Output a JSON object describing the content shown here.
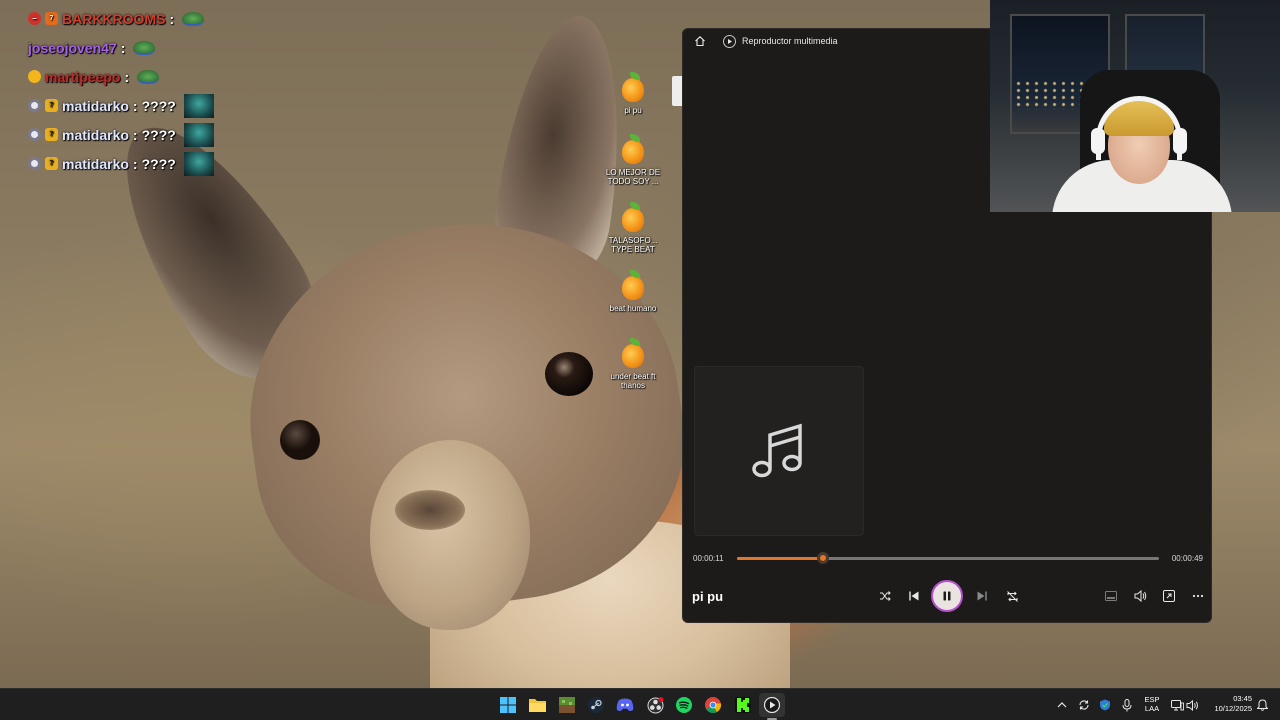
{
  "chat": {
    "lines": [
      {
        "user": "BARKKROOMS",
        "user_color": "#d43c2c",
        "separator": ":",
        "message": "",
        "badges": [
          "no-entry-icon",
          "seventv-badge-icon"
        ],
        "emotes": [
          "turtle-emote"
        ]
      },
      {
        "user": "joseojoven47",
        "user_color": "#a562e6",
        "separator": ":",
        "message": "",
        "badges": [],
        "emotes": [
          "turtle-emote"
        ]
      },
      {
        "user": "martipeepo",
        "user_color": "#c42a2a",
        "separator": ":",
        "message": "",
        "badges": [
          "yellow-circle-badge-icon"
        ],
        "emotes": [
          "turtle-emote"
        ]
      },
      {
        "user": "matidarko",
        "user_color": "#dfe6ff",
        "separator": ":",
        "message": " ????",
        "badges": [
          "subscriber-badge-icon",
          "seventv-badge-icon"
        ],
        "emotes": [
          "teal-emote"
        ]
      },
      {
        "user": "matidarko",
        "user_color": "#dfe6ff",
        "separator": ":",
        "message": " ????",
        "badges": [
          "subscriber-badge-icon",
          "seventv-badge-icon"
        ],
        "emotes": [
          "teal-emote"
        ]
      },
      {
        "user": "matidarko",
        "user_color": "#dfe6ff",
        "separator": ":",
        "message": " ????",
        "badges": [
          "subscriber-badge-icon",
          "seventv-badge-icon"
        ],
        "emotes": [
          "teal-emote"
        ]
      }
    ]
  },
  "desktop": {
    "icons": [
      {
        "label": "pi pu",
        "icon": "fl-studio-icon"
      },
      {
        "label": "LO MEJOR DE TODO SOY ...",
        "icon": "fl-studio-icon"
      },
      {
        "label": "TALASOFO... TYPE BEAT",
        "icon": "fl-studio-icon"
      },
      {
        "label": "beat humano",
        "icon": "fl-studio-icon"
      },
      {
        "label": "under beat ft thanos",
        "icon": "fl-studio-icon"
      }
    ]
  },
  "player": {
    "app_title": "Reproductor multimedia",
    "track_title": "pi pu",
    "time_elapsed": "00:00:11",
    "time_total": "00:00:49",
    "progress_fraction": 0.204,
    "accent_color": "#e2762a",
    "album_art_icon": "music-note-icon",
    "controls": [
      "shuffle-icon",
      "previous-icon",
      "pause-icon",
      "next-icon",
      "repeat-off-icon"
    ],
    "right_controls": [
      "miniplayer-icon",
      "volume-icon",
      "cast-icon",
      "more-icon"
    ]
  },
  "taskbar": {
    "apps": [
      "windows-start-icon",
      "file-explorer-icon",
      "minecraft-icon",
      "steam-icon",
      "discord-icon",
      "obs-icon",
      "spotify-icon",
      "chrome-icon",
      "kick-icon",
      "media-player-icon"
    ],
    "tray_icons": [
      "chevron-up-icon",
      "sync-icon",
      "defender-icon",
      "microphone-icon"
    ],
    "language": "ESP",
    "keyboard_layout": "LAA",
    "time": "03:45",
    "date": "10/12/2025"
  }
}
